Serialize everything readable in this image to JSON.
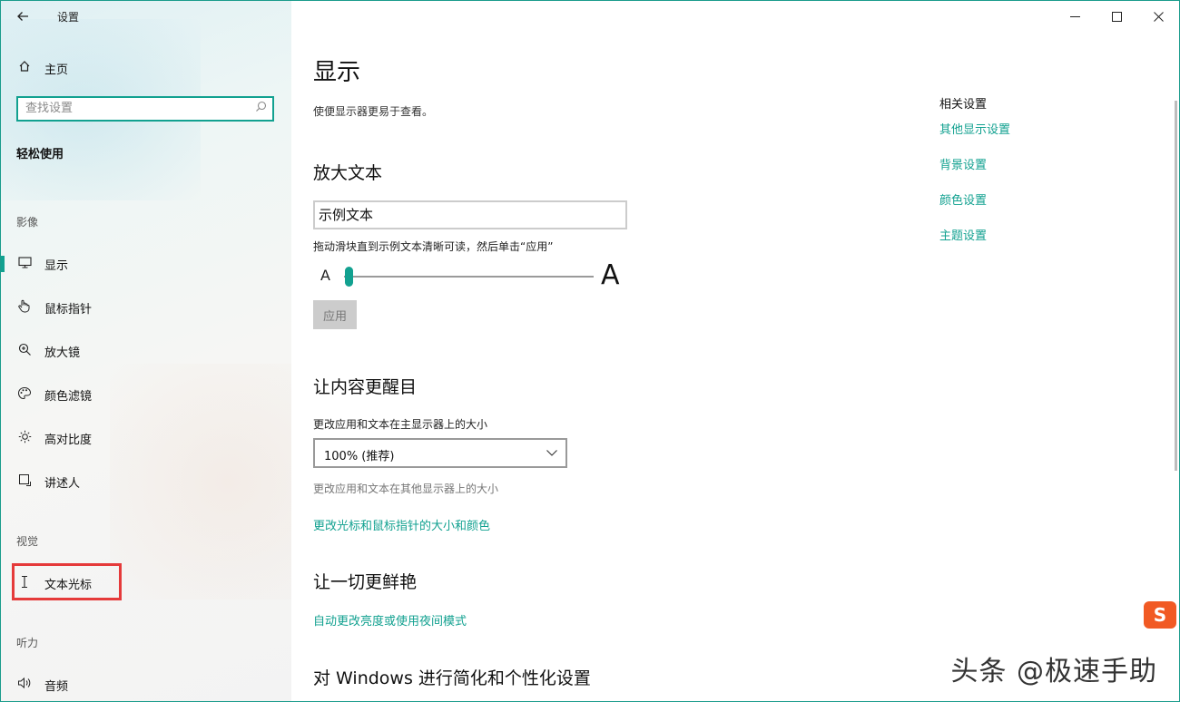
{
  "window": {
    "title": "设置"
  },
  "sidebar": {
    "home_label": "主页",
    "search_placeholder": "查找设置",
    "section_title": "轻松使用",
    "groups": {
      "vision_label": "影像",
      "vision2_label": "视觉",
      "hearing_label": "听力"
    },
    "items": [
      {
        "label": "显示"
      },
      {
        "label": "鼠标指针"
      },
      {
        "label": "放大镜"
      },
      {
        "label": "颜色滤镜"
      },
      {
        "label": "高对比度"
      },
      {
        "label": "讲述人"
      },
      {
        "label": "文本光标"
      },
      {
        "label": "音频"
      }
    ]
  },
  "main": {
    "title": "显示",
    "subtitle": "使便显示器更易于查看。",
    "enlarge": {
      "heading": "放大文本",
      "sample_text": "示例文本",
      "hint": "拖动滑块直到示例文本清晰可读，然后单击“应用”",
      "slider_min_label": "A",
      "slider_max_label": "A",
      "slider_value_percent": 2,
      "apply_label": "应用"
    },
    "bigger": {
      "heading": "让内容更醒目",
      "main_display_label": "更改应用和文本在主显示器上的大小",
      "scale_value": "100% (推荐)",
      "other_display_label": "更改应用和文本在其他显示器上的大小",
      "pointer_link": "更改光标和鼠标指针的大小和颜色"
    },
    "brighter": {
      "heading": "让一切更鲜艳",
      "auto_link": "自动更改亮度或使用夜间模式"
    },
    "simplify": {
      "heading": "对 Windows 进行简化和个性化设置"
    }
  },
  "related": {
    "title": "相关设置",
    "links": [
      "其他显示设置",
      "背景设置",
      "颜色设置",
      "主题设置"
    ]
  },
  "overlay": {
    "brand_letter": "S",
    "watermark": "头条 @极速手助"
  },
  "colors": {
    "accent": "#12a190",
    "highlight": "#e53a3a",
    "brand": "#f15a24"
  }
}
